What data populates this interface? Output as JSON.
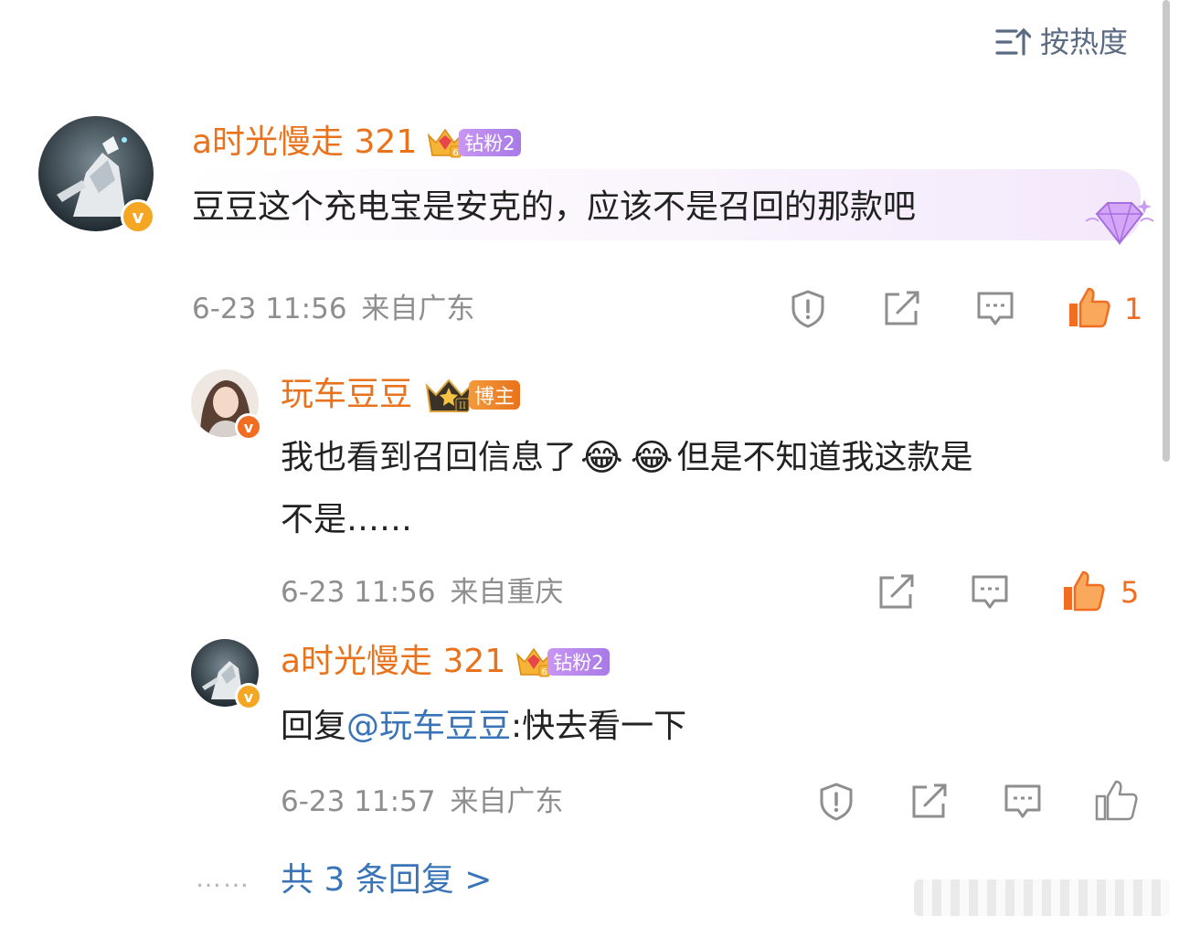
{
  "sort": {
    "label": "按热度",
    "icon": "sort-icon"
  },
  "comment": {
    "username": "a时光慢走 321",
    "badge_label": "钻粉2",
    "badge_level": "6",
    "text": "豆豆这个充电宝是安克的，应该不是召回的那款吧",
    "time": "6-23 11:56",
    "location": "来自广东",
    "like_count": "1",
    "liked": true
  },
  "replies": [
    {
      "username": "玩车豆豆",
      "badge_label": "博主",
      "badge_level": "II",
      "text_part1": "我也看到召回信息了",
      "emoji": "😂",
      "text_part2": "但是不知道我这款是",
      "text_line2": "不是……",
      "time": "6-23 11:56",
      "location": "来自重庆",
      "like_count": "5",
      "liked": true
    },
    {
      "username": "a时光慢走 321",
      "badge_label": "钻粉2",
      "badge_level": "6",
      "reply_prefix": "回复",
      "mention": "@玩车豆豆",
      "reply_text": ":快去看一下",
      "time": "6-23 11:57",
      "location": "来自广东",
      "liked": false
    }
  ],
  "more_replies": {
    "dots": "……",
    "label": "共 3 条回复 >"
  },
  "colors": {
    "username": "#e8731c",
    "like_active": "#f06d22",
    "link": "#3a74b8",
    "meta": "#8e8e8e",
    "fan_badge": "#b487ec",
    "verified": "#f5a623"
  }
}
